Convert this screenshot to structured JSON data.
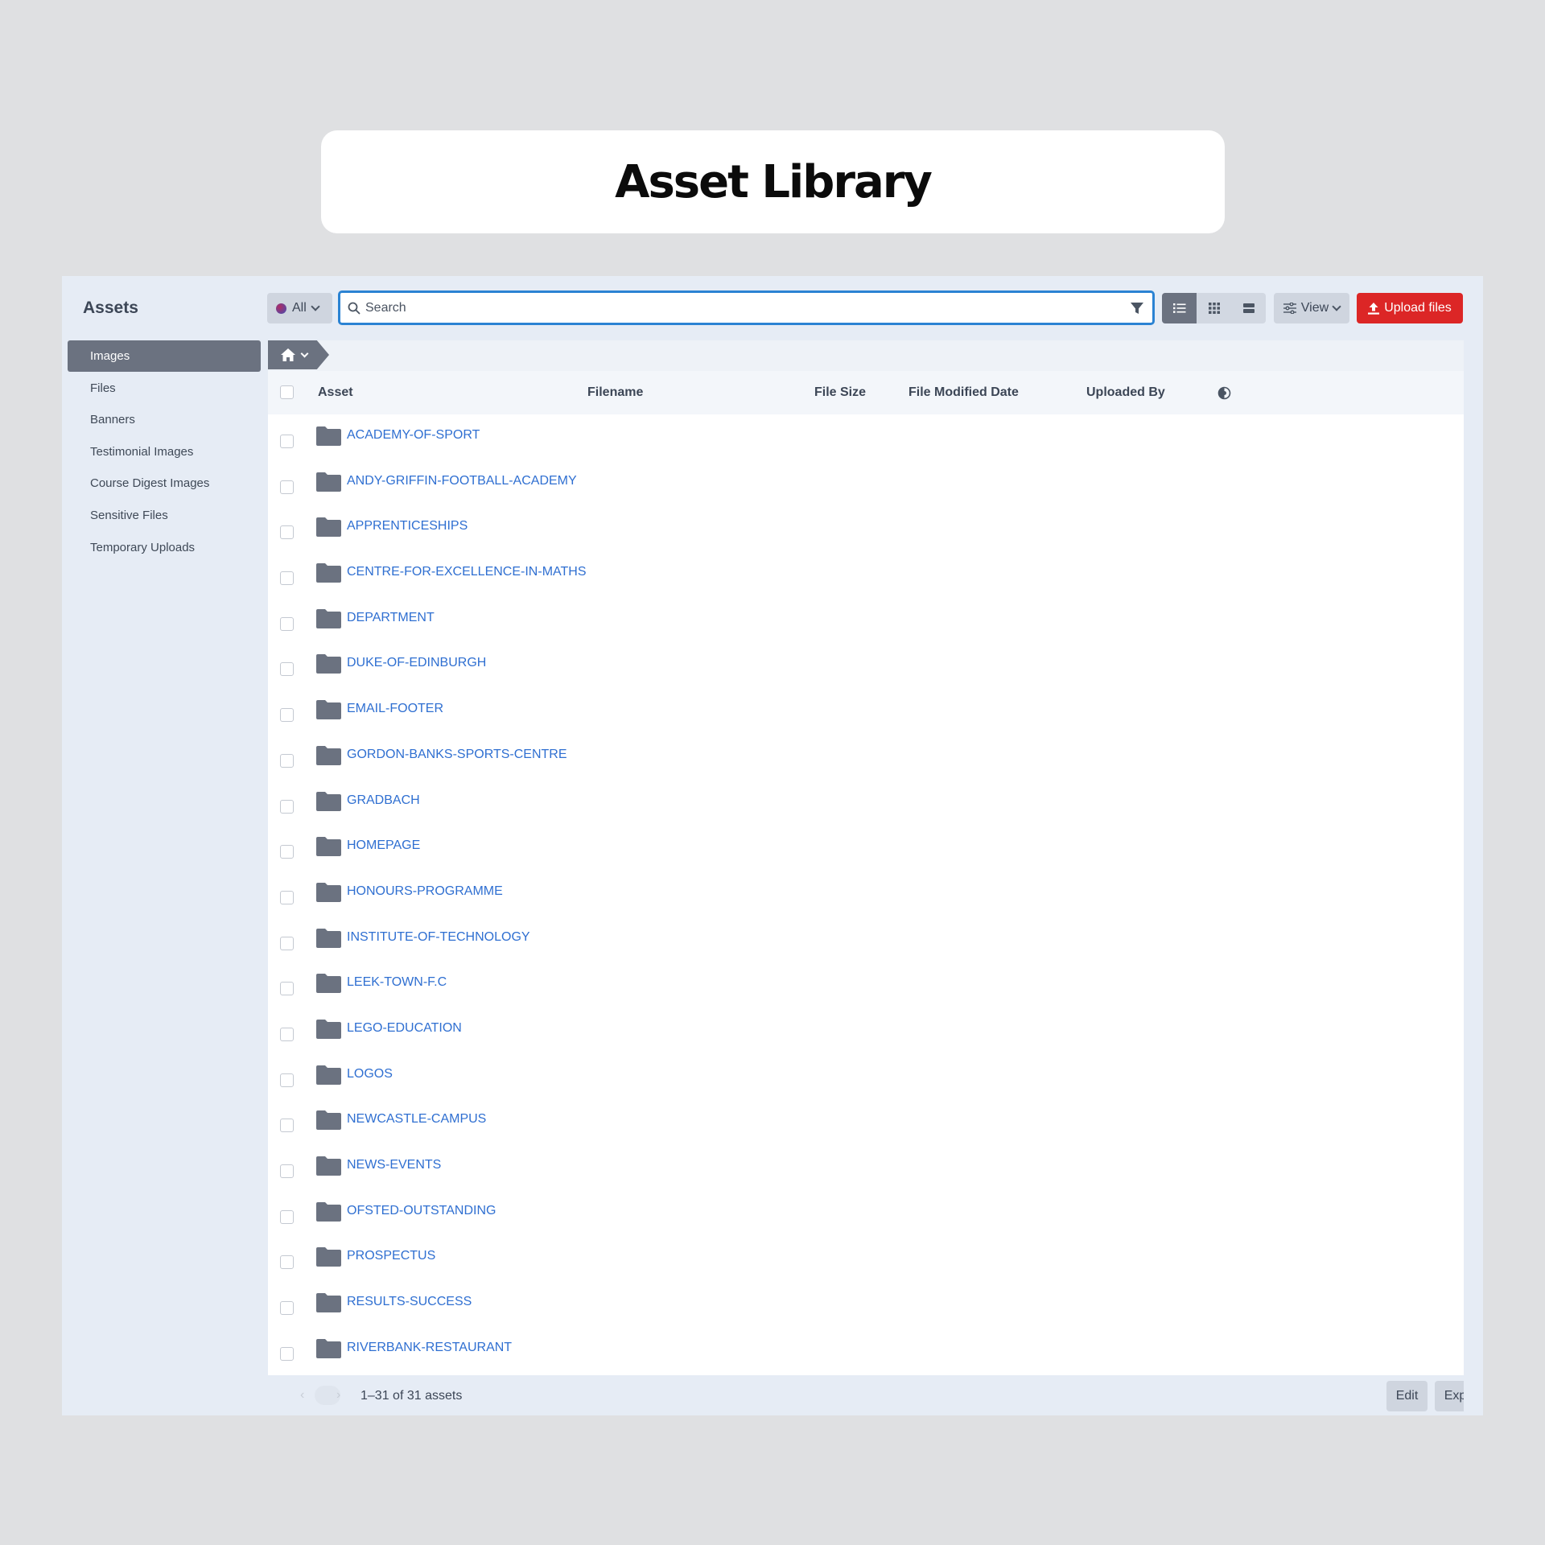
{
  "page_title": "Asset Library",
  "sidebar": {
    "title": "Assets",
    "items": [
      {
        "label": "Images",
        "active": true
      },
      {
        "label": "Files"
      },
      {
        "label": "Banners"
      },
      {
        "label": "Testimonial Images"
      },
      {
        "label": "Course Digest Images"
      },
      {
        "label": "Sensitive Files"
      },
      {
        "label": "Temporary Uploads"
      }
    ]
  },
  "toolbar": {
    "scope_label": "All",
    "search_placeholder": "Search",
    "view_label": "View",
    "upload_label": "Upload files",
    "active_view": "list"
  },
  "table": {
    "columns": [
      "Asset",
      "Filename",
      "File Size",
      "File Modified Date",
      "Uploaded By"
    ],
    "rows": [
      "ACADEMY-OF-SPORT",
      "ANDY-GRIFFIN-FOOTBALL-ACADEMY",
      "APPRENTICESHIPS",
      "CENTRE-FOR-EXCELLENCE-IN-MATHS",
      "DEPARTMENT",
      "DUKE-OF-EDINBURGH",
      "EMAIL-FOOTER",
      "GORDON-BANKS-SPORTS-CENTRE",
      "GRADBACH",
      "HOMEPAGE",
      "HONOURS-PROGRAMME",
      "INSTITUTE-OF-TECHNOLOGY",
      "LEEK-TOWN-F.C",
      "LEGO-EDUCATION",
      "LOGOS",
      "NEWCASTLE-CAMPUS",
      "NEWS-EVENTS",
      "OFSTED-OUTSTANDING",
      "PROSPECTUS",
      "RESULTS-SUCCESS",
      "RIVERBANK-RESTAURANT"
    ]
  },
  "footer": {
    "count_text": "1–31 of 31 assets",
    "edit_label": "Edit",
    "export_label": "Export..."
  },
  "colors": {
    "accent": "#2b83d3",
    "upload": "#dc2626",
    "link": "#2f6fd1",
    "active_nav": "#6b7280"
  }
}
